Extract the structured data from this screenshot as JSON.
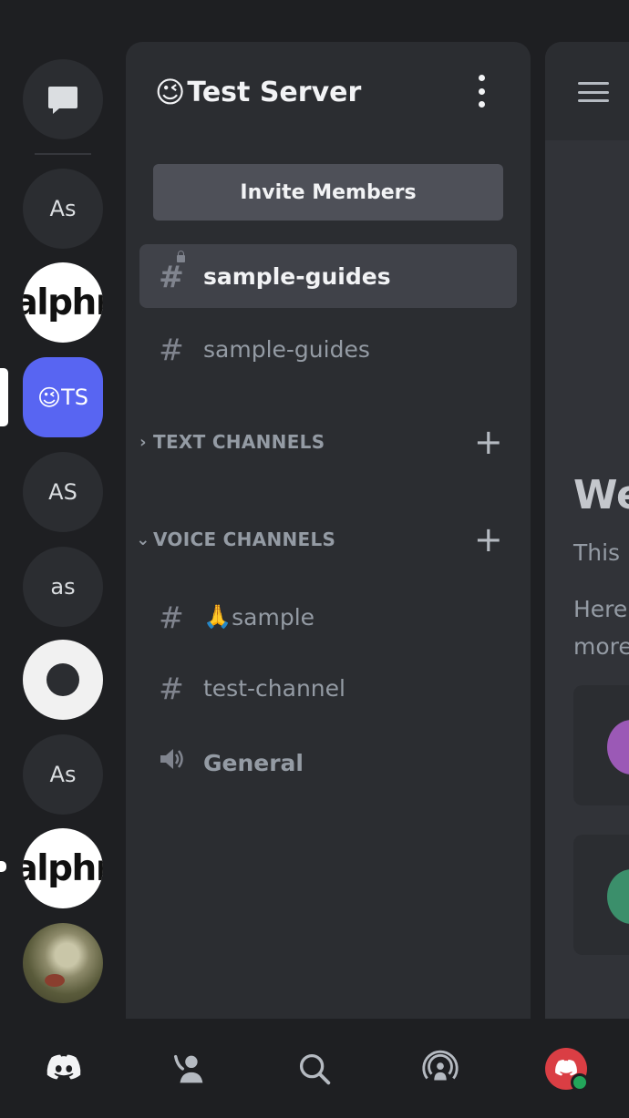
{
  "server_rail": {
    "servers": [
      {
        "label": "As"
      },
      {
        "label": "alphr"
      },
      {
        "label": "TS",
        "emoji": "😉"
      },
      {
        "label": "AS"
      },
      {
        "label": "as"
      },
      {
        "label": "As"
      },
      {
        "label": "alphr"
      }
    ]
  },
  "sidebar": {
    "server_emoji": "😉",
    "server_name": "Test Server",
    "invite_label": "Invite Members",
    "top_channels": [
      {
        "name": "sample-guides",
        "icon": "hash-lock-icon",
        "selected": true
      },
      {
        "name": "sample-guides",
        "icon": "hash-icon",
        "selected": false
      }
    ],
    "categories": [
      {
        "name": "TEXT CHANNELS",
        "chevron": "›",
        "plus": "+"
      },
      {
        "name": "VOICE CHANNELS",
        "chevron": "⌄",
        "plus": "+"
      }
    ],
    "voice_channels": [
      {
        "name": "sample",
        "emoji": "🙏",
        "icon": "hash-icon"
      },
      {
        "name": "test-channel",
        "icon": "hash-icon"
      },
      {
        "name": "General",
        "icon": "speaker-icon"
      }
    ]
  },
  "main": {
    "welcome_partial": "We",
    "line1_partial": "This",
    "line2_partial": "Here",
    "line3_partial": "more"
  },
  "colors": {
    "accent": "#5865f2",
    "background": "#1e1f22",
    "sidebar": "#2b2d31",
    "selected_channel": "#404249",
    "online": "#23a55a",
    "avatar": "#da3e44"
  },
  "bottom_nav": {
    "tabs": [
      "home-icon",
      "friends-icon",
      "search-icon",
      "mentions-icon",
      "profile-avatar"
    ]
  }
}
